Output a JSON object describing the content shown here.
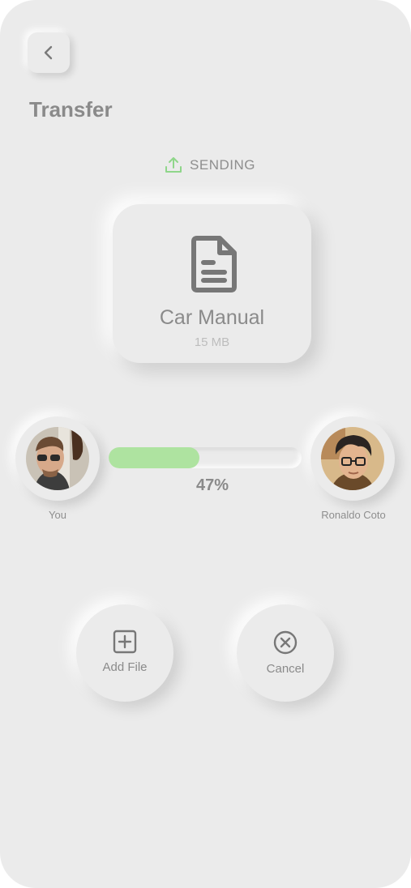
{
  "header": {
    "back_label": "",
    "title": "Transfer"
  },
  "status": {
    "icon": "upload-icon",
    "text": "SENDING",
    "color": "#8fd68a"
  },
  "file": {
    "icon": "document-icon",
    "name": "Car Manual",
    "size": "15 MB"
  },
  "transfer": {
    "sender": {
      "name": "You",
      "avatar": "avatar-you"
    },
    "recipient": {
      "name": "Ronaldo Coto",
      "avatar": "avatar-ronaldo"
    },
    "progress_percent": 47,
    "progress_label": "47%",
    "progress_color": "#aee3a0"
  },
  "actions": {
    "add_file_label": "Add File",
    "add_file_icon": "plus-square-icon",
    "cancel_label": "Cancel",
    "cancel_icon": "close-circle-icon"
  },
  "colors": {
    "background": "#ebebeb",
    "text": "#8a8a8a",
    "accent": "#8fd68a"
  }
}
